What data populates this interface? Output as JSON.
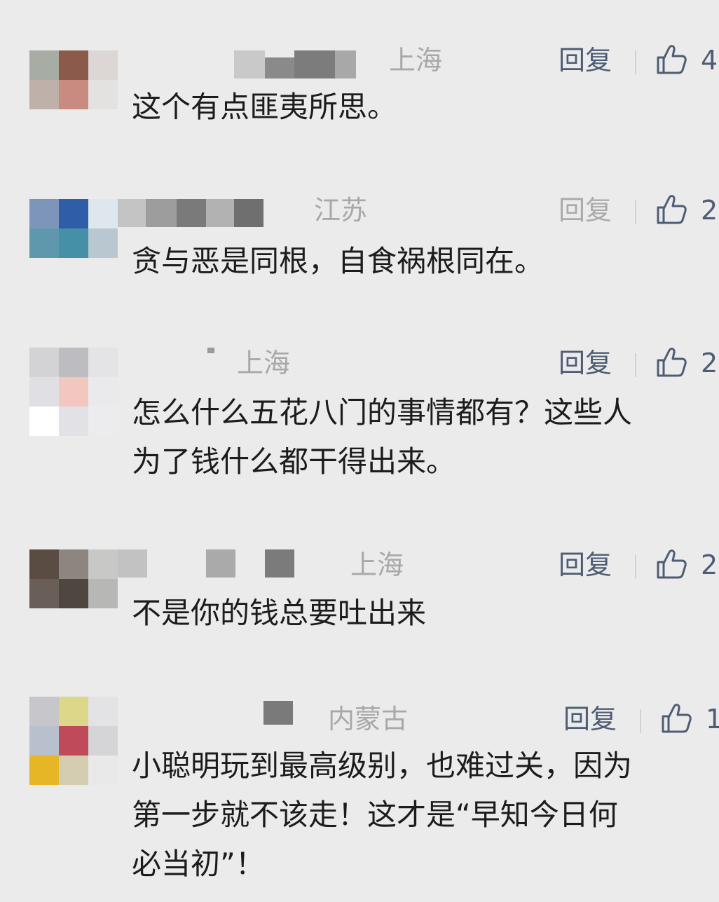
{
  "comments": [
    {
      "region": "上海",
      "reply_label": "回复",
      "like_count": "4",
      "text": "这个有点匪夷所思。"
    },
    {
      "region": "江苏",
      "reply_label": "回复",
      "like_count": "2",
      "text": "贪与恶是同根，自食祸根同在。"
    },
    {
      "region": "上海",
      "reply_label": "回复",
      "like_count": "2",
      "text": "怎么什么五花八门的事情都有？这些人\n为了钱什么都干得出来。"
    },
    {
      "region": "上海",
      "reply_label": "回复",
      "like_count": "2",
      "text": "不是你的钱总要吐出来"
    },
    {
      "region": "内蒙古",
      "reply_label": "回复",
      "like_count": "1",
      "text": "小聪明玩到最高级别，也难过关，因为\n第一步就不该走！这才是“早知今日何\n必当初”！"
    }
  ],
  "avatar_colors": [
    [
      "#a7aca5",
      "#8b5a4a",
      "#dcd6d4",
      "#bfb0aa",
      "#c98b80",
      "#e4e2e1",
      "#ebebeb",
      "#ebebeb",
      "#ebebeb"
    ],
    [
      "#7d95ba",
      "#2f5da8",
      "#dfe7ee",
      "#5f98ad",
      "#4590a6",
      "#b9c7d0",
      "#ebebeb",
      "#ebebeb",
      "#ebebeb"
    ],
    [
      "#d3d3d6",
      "#bdbcc0",
      "#e4e3e6",
      "#e0dfe3",
      "#f2c7bf",
      "#eaeaec",
      "#ffffff",
      "#e2e2e6",
      "#ececee"
    ],
    [
      "#5a4c43",
      "#8d8580",
      "#c8c8c6",
      "#6a5e58",
      "#4f4640",
      "#b7b7b5",
      "#ebebeb",
      "#ebebeb",
      "#ebebeb"
    ],
    [
      "#c7c7cb",
      "#ddd789",
      "#e3e3e5",
      "#b8bfcd",
      "#bf4b5a",
      "#d5d5d8",
      "#e7b627",
      "#d4cdb2",
      "#e9e9ea"
    ]
  ]
}
